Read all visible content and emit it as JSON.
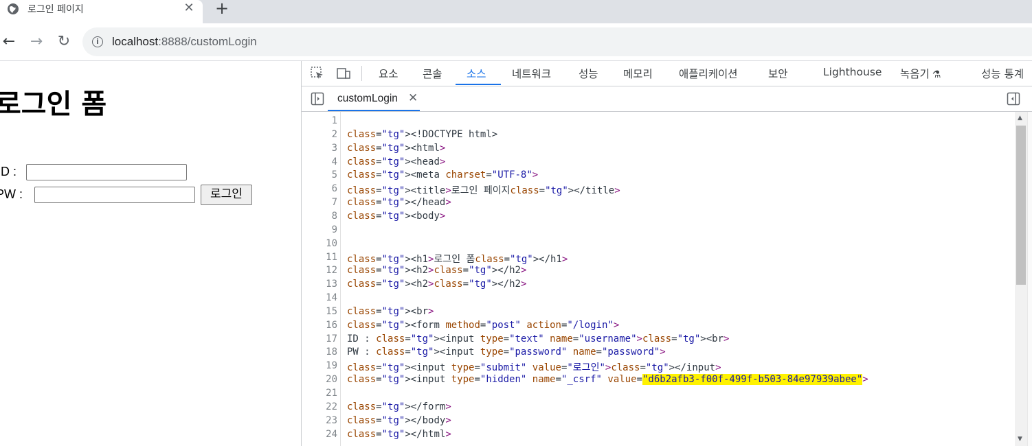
{
  "browser": {
    "tab_title": "로그인 페이지",
    "new_tab": "+",
    "close_glyph": "✕",
    "url_host": "localhost",
    "url_path": ":8888/customLogin",
    "back_glyph": "←",
    "forward_glyph": "→",
    "reload_glyph": "↻",
    "info_glyph": "i"
  },
  "page": {
    "heading": "로그인 폼",
    "id_label": "ID :",
    "pw_label": "PW :",
    "submit_label": "로그인"
  },
  "devtools": {
    "tabs": [
      "요소",
      "콘솔",
      "소스",
      "네트워크",
      "성능",
      "메모리",
      "애플리케이션",
      "보안",
      "Lighthouse",
      "녹음기",
      "성능 통계"
    ],
    "active_tab": "소스",
    "file_tab": "customLogin",
    "flask_glyph": "⚗",
    "code_lines": [
      "",
      "<!DOCTYPE html>",
      "<html>",
      "<head>",
      "<meta charset=\"UTF-8\">",
      "<title>로그인 페이지</title>",
      "</head>",
      "<body>",
      "",
      "",
      "<h1>로그인 폼</h1>",
      "<h2></h2>",
      "<h2></h2>",
      "",
      "<br>",
      "<form method=\"post\" action=\"/login\">",
      "ID : <input type=\"text\" name=\"username\"><br>",
      "PW : <input type=\"password\" name=\"password\">",
      "<input type=\"submit\" value=\"로그인\"></input>",
      "<input type=\"hidden\" name=\"_csrf\" value=\"d6b2afb3-f00f-499f-b503-84e97939abee\">",
      "",
      "</form>",
      "</body>",
      "</html>"
    ],
    "highlight_color": "#fff200",
    "accent_color": "#1a73e8"
  }
}
